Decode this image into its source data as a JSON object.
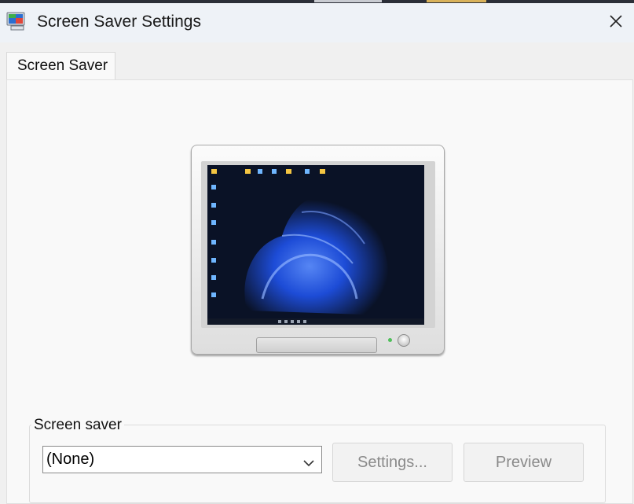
{
  "window": {
    "title": "Screen Saver Settings",
    "close_label": "Close"
  },
  "tabs": [
    {
      "label": "Screen Saver",
      "active": true
    }
  ],
  "screen_saver_group": {
    "label": "Screen saver",
    "selected_value": "(None)",
    "settings_label": "Settings...",
    "preview_label": "Preview",
    "settings_enabled": false,
    "preview_enabled": false
  },
  "icons": {
    "app": "display-icon",
    "close": "close-icon",
    "dropdown": "chevron-down-icon"
  },
  "colors": {
    "accent_blue": "#1e4fe0",
    "screen_background": "#0a1226",
    "led": "#4fbf5a"
  }
}
